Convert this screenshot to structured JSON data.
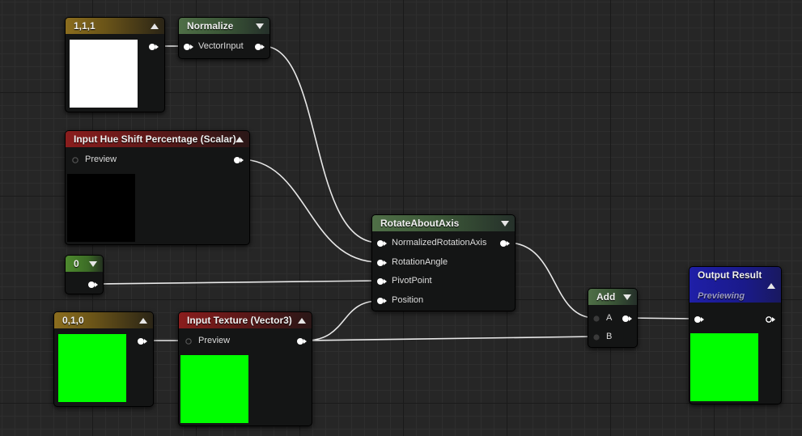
{
  "nodes": {
    "const_111": {
      "title": "1,1,1",
      "preview_color": "#ffffff"
    },
    "normalize": {
      "title": "Normalize",
      "pin_in": "VectorInput"
    },
    "hue_shift": {
      "title": "Input Hue Shift Percentage (Scalar)",
      "preview_label": "Preview",
      "preview_color": "#000000"
    },
    "const_0": {
      "title": "0"
    },
    "const_010": {
      "title": "0,1,0",
      "preview_color": "#00ff00"
    },
    "input_texture": {
      "title": "Input Texture (Vector3)",
      "preview_label": "Preview",
      "preview_color": "#00ff00"
    },
    "rotate": {
      "title": "RotateAboutAxis",
      "pins": [
        "NormalizedRotationAxis",
        "RotationAngle",
        "PivotPoint",
        "Position"
      ]
    },
    "add": {
      "title": "Add",
      "pin_a": "A",
      "pin_b": "B"
    },
    "output": {
      "title": "Output Result",
      "subtitle": "Previewing",
      "preview_color": "#00ff00"
    }
  },
  "colors": {
    "wire": "#e8e8e8",
    "pin": "#ffffff",
    "header_constant": "#8b6d1e",
    "header_function": "#4f6f47",
    "header_input": "#8a1d1d",
    "header_output": "#1f1fa8"
  }
}
